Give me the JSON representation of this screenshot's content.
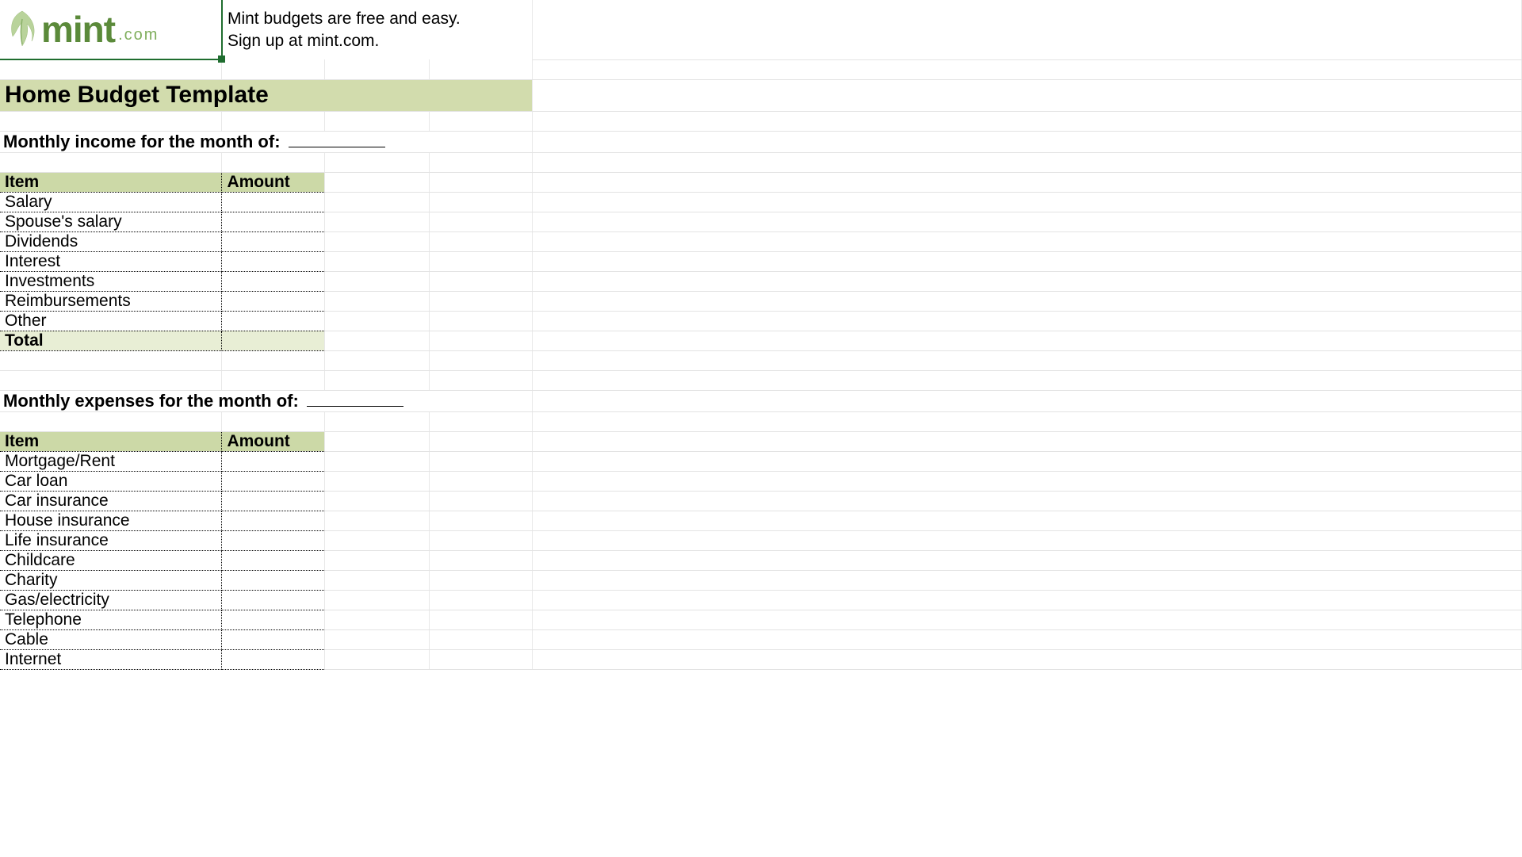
{
  "brand": {
    "name": "mint",
    "tld": ".com"
  },
  "tagline": {
    "line1": "Mint budgets are free and easy.",
    "line2": "Sign up at mint.com."
  },
  "title": "Home Budget Template",
  "income": {
    "section_label": "Monthly income for the month of:",
    "header_item": "Item",
    "header_amount": "Amount",
    "rows": [
      "Salary",
      "Spouse's salary",
      "Dividends",
      "Interest",
      "Investments",
      "Reimbursements",
      "Other"
    ],
    "total_label": "Total"
  },
  "expenses": {
    "section_label": "Monthly expenses for the month of:",
    "header_item": "Item",
    "header_amount": "Amount",
    "rows": [
      "Mortgage/Rent",
      "Car loan",
      "Car insurance",
      "House insurance",
      "Life insurance",
      "Childcare",
      "Charity",
      "Gas/electricity",
      "Telephone",
      "Cable",
      "Internet"
    ]
  },
  "colors": {
    "brand_green": "#1f6d2f",
    "header_olive": "#ccd9a7",
    "title_olive": "#d2dcad",
    "total_olive": "#e8eed5"
  }
}
